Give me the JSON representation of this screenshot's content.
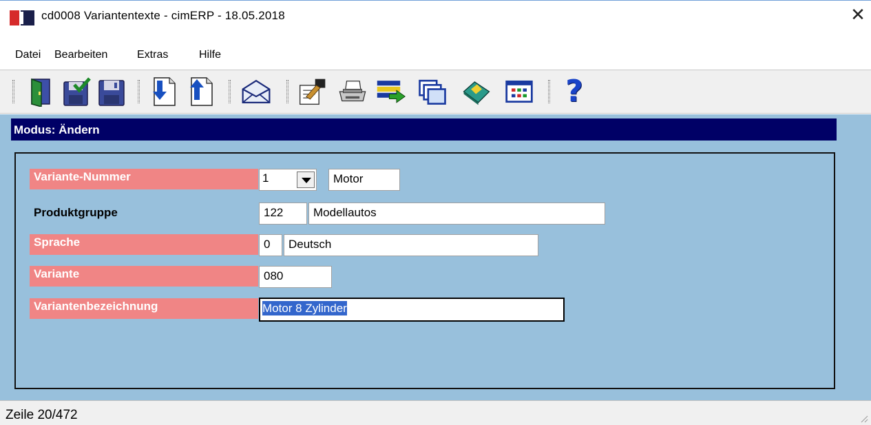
{
  "window": {
    "title": "cd0008 Variantentexte - cimERP - 18.05.2018",
    "close_symbol": "✕"
  },
  "menu": {
    "items": [
      "Datei",
      "Bearbeiten",
      "Extras",
      "Hilfe"
    ]
  },
  "toolbar": {
    "icons": [
      "exit-door-icon",
      "save-check-icon",
      "save-icon",
      "move-down-icon",
      "move-up-icon",
      "mail-icon",
      "edit-note-icon",
      "print-icon",
      "list-transfer-icon",
      "windows-icon",
      "book-icon",
      "grid-table-icon",
      "help-icon"
    ],
    "help_symbol": "?"
  },
  "mode": {
    "text": "Modus: Ändern"
  },
  "form": {
    "variante_nummer": {
      "label": "Variante-Nummer",
      "value": "1",
      "description": "Motor"
    },
    "produktgruppe": {
      "label": "Produktgruppe",
      "code": "122",
      "name": "Modellautos"
    },
    "sprache": {
      "label": "Sprache",
      "code": "0",
      "name": "Deutsch"
    },
    "variante": {
      "label": "Variante",
      "value": "080"
    },
    "variantenbezeichnung": {
      "label": "Variantenbezeichnung",
      "value": "Motor 8 Zylinder"
    }
  },
  "colors": {
    "mode_bar": "#000066",
    "required_label": "#f08585",
    "background": "#98c0dc",
    "selection": "#3366cc"
  },
  "status": {
    "text": "Zeile 20/472"
  }
}
